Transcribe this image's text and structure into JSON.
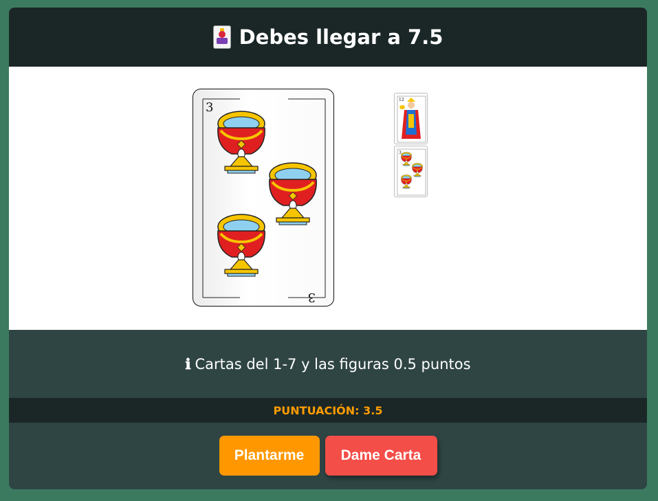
{
  "header": {
    "icon": "joker-card-icon",
    "title": "Debes llegar a 7.5"
  },
  "current_card": {
    "value": "3",
    "suit": "copas",
    "corner_top": "3",
    "corner_bottom": "3"
  },
  "hand": {
    "cards": [
      {
        "label": "12",
        "figure": "rey",
        "suit": "copas"
      },
      {
        "label": "3",
        "suit": "copas"
      }
    ]
  },
  "info": {
    "icon": "info-icon",
    "icon_glyph": "ℹ",
    "text": "Cartas del 1-7 y las figuras 0.5 puntos"
  },
  "score": {
    "text": "PUNTUACIÓN: 3.5"
  },
  "buttons": {
    "stand_label": "Plantarme",
    "draw_label": "Dame Carta"
  },
  "colors": {
    "background": "#3c7a5f",
    "header": "#1b2727",
    "panel": "#2f4544",
    "score": "#ff9d00",
    "stand_button": "#ff9800",
    "draw_button": "#f44e48"
  }
}
